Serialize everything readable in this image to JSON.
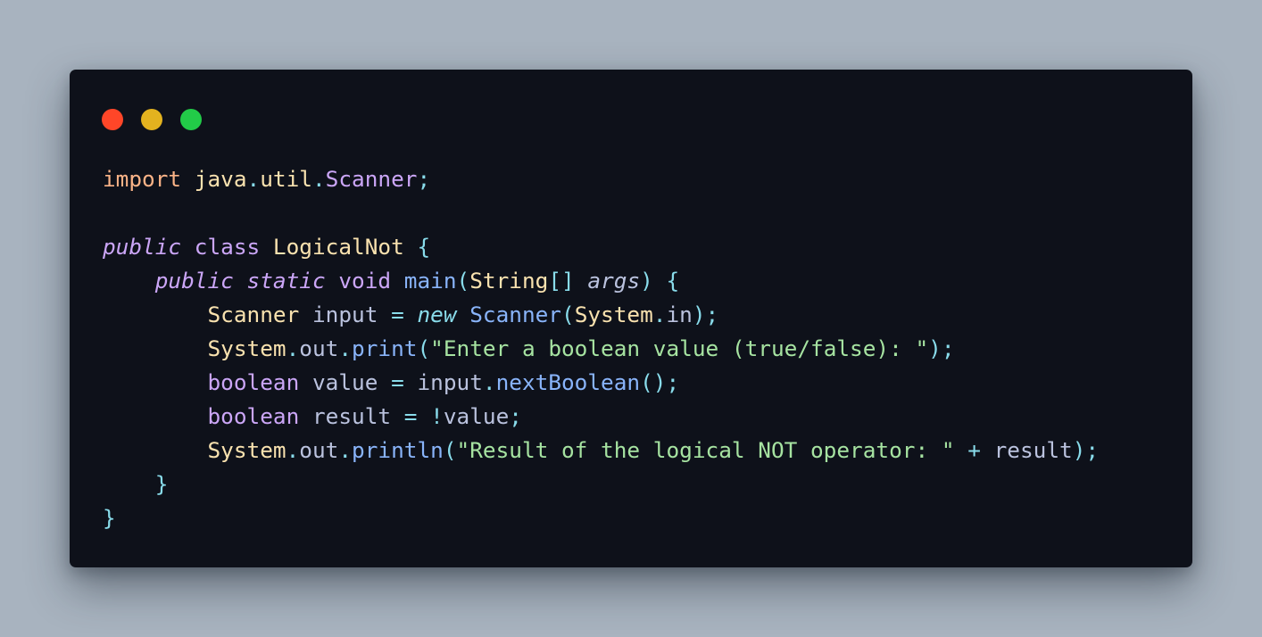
{
  "window": {
    "controls": [
      {
        "name": "close",
        "color": "#ff4628"
      },
      {
        "name": "minimize",
        "color": "#e3b21f"
      },
      {
        "name": "maximize",
        "color": "#22cb48"
      }
    ]
  },
  "colors": {
    "background": "#a8b3bf",
    "editor": "#0e111a",
    "keyword": "#cba6f7",
    "import": "#fab387",
    "type": "#f9e2af",
    "function": "#89b4fa",
    "string": "#a6e3a1",
    "punct": "#89dceb",
    "plain": "#bac2de",
    "italic_new": "#89dceb"
  },
  "code": {
    "lines": [
      [
        {
          "t": "import",
          "c": "#fab387"
        },
        {
          "t": " ",
          "c": "#bac2de"
        },
        {
          "t": "java",
          "c": "#f9e2af"
        },
        {
          "t": ".",
          "c": "#89dceb"
        },
        {
          "t": "util",
          "c": "#f9e2af"
        },
        {
          "t": ".",
          "c": "#89dceb"
        },
        {
          "t": "Scanner",
          "c": "#cba6f7"
        },
        {
          "t": ";",
          "c": "#89dceb"
        }
      ],
      [],
      [
        {
          "t": "public",
          "c": "#cba6f7",
          "i": true
        },
        {
          "t": " ",
          "c": "#bac2de"
        },
        {
          "t": "class",
          "c": "#cba6f7"
        },
        {
          "t": " ",
          "c": "#bac2de"
        },
        {
          "t": "LogicalNot",
          "c": "#f9e2af"
        },
        {
          "t": " {",
          "c": "#89dceb"
        }
      ],
      [
        {
          "t": "    ",
          "c": "#bac2de"
        },
        {
          "t": "public",
          "c": "#cba6f7",
          "i": true
        },
        {
          "t": " ",
          "c": "#bac2de"
        },
        {
          "t": "static",
          "c": "#cba6f7",
          "i": true
        },
        {
          "t": " ",
          "c": "#bac2de"
        },
        {
          "t": "void",
          "c": "#cba6f7"
        },
        {
          "t": " ",
          "c": "#bac2de"
        },
        {
          "t": "main",
          "c": "#89b4fa"
        },
        {
          "t": "(",
          "c": "#89dceb"
        },
        {
          "t": "String",
          "c": "#f9e2af"
        },
        {
          "t": "[]",
          "c": "#89dceb"
        },
        {
          "t": " ",
          "c": "#bac2de"
        },
        {
          "t": "args",
          "c": "#bac2de",
          "i": true
        },
        {
          "t": ") {",
          "c": "#89dceb"
        }
      ],
      [
        {
          "t": "        ",
          "c": "#bac2de"
        },
        {
          "t": "Scanner",
          "c": "#f9e2af"
        },
        {
          "t": " input ",
          "c": "#bac2de"
        },
        {
          "t": "=",
          "c": "#89dceb"
        },
        {
          "t": " ",
          "c": "#bac2de"
        },
        {
          "t": "new",
          "c": "#89dceb",
          "i": true
        },
        {
          "t": " ",
          "c": "#bac2de"
        },
        {
          "t": "Scanner",
          "c": "#89b4fa"
        },
        {
          "t": "(",
          "c": "#89dceb"
        },
        {
          "t": "System",
          "c": "#f9e2af"
        },
        {
          "t": ".",
          "c": "#89dceb"
        },
        {
          "t": "in",
          "c": "#bac2de"
        },
        {
          "t": ");",
          "c": "#89dceb"
        }
      ],
      [
        {
          "t": "        ",
          "c": "#bac2de"
        },
        {
          "t": "System",
          "c": "#f9e2af"
        },
        {
          "t": ".",
          "c": "#89dceb"
        },
        {
          "t": "out",
          "c": "#bac2de"
        },
        {
          "t": ".",
          "c": "#89dceb"
        },
        {
          "t": "print",
          "c": "#89b4fa"
        },
        {
          "t": "(",
          "c": "#89dceb"
        },
        {
          "t": "\"Enter a boolean value (true/false): \"",
          "c": "#a6e3a1"
        },
        {
          "t": ");",
          "c": "#89dceb"
        }
      ],
      [
        {
          "t": "        ",
          "c": "#bac2de"
        },
        {
          "t": "boolean",
          "c": "#cba6f7"
        },
        {
          "t": " value ",
          "c": "#bac2de"
        },
        {
          "t": "=",
          "c": "#89dceb"
        },
        {
          "t": " input",
          "c": "#bac2de"
        },
        {
          "t": ".",
          "c": "#89dceb"
        },
        {
          "t": "nextBoolean",
          "c": "#89b4fa"
        },
        {
          "t": "();",
          "c": "#89dceb"
        }
      ],
      [
        {
          "t": "        ",
          "c": "#bac2de"
        },
        {
          "t": "boolean",
          "c": "#cba6f7"
        },
        {
          "t": " result ",
          "c": "#bac2de"
        },
        {
          "t": "=",
          "c": "#89dceb"
        },
        {
          "t": " ",
          "c": "#bac2de"
        },
        {
          "t": "!",
          "c": "#89dceb"
        },
        {
          "t": "value",
          "c": "#bac2de"
        },
        {
          "t": ";",
          "c": "#89dceb"
        }
      ],
      [
        {
          "t": "        ",
          "c": "#bac2de"
        },
        {
          "t": "System",
          "c": "#f9e2af"
        },
        {
          "t": ".",
          "c": "#89dceb"
        },
        {
          "t": "out",
          "c": "#bac2de"
        },
        {
          "t": ".",
          "c": "#89dceb"
        },
        {
          "t": "println",
          "c": "#89b4fa"
        },
        {
          "t": "(",
          "c": "#89dceb"
        },
        {
          "t": "\"Result of the logical NOT operator: \"",
          "c": "#a6e3a1"
        },
        {
          "t": " ",
          "c": "#bac2de"
        },
        {
          "t": "+",
          "c": "#89dceb"
        },
        {
          "t": " result",
          "c": "#bac2de"
        },
        {
          "t": ");",
          "c": "#89dceb"
        }
      ],
      [
        {
          "t": "    ",
          "c": "#bac2de"
        },
        {
          "t": "}",
          "c": "#89dceb"
        }
      ],
      [
        {
          "t": "}",
          "c": "#89dceb"
        }
      ]
    ]
  }
}
